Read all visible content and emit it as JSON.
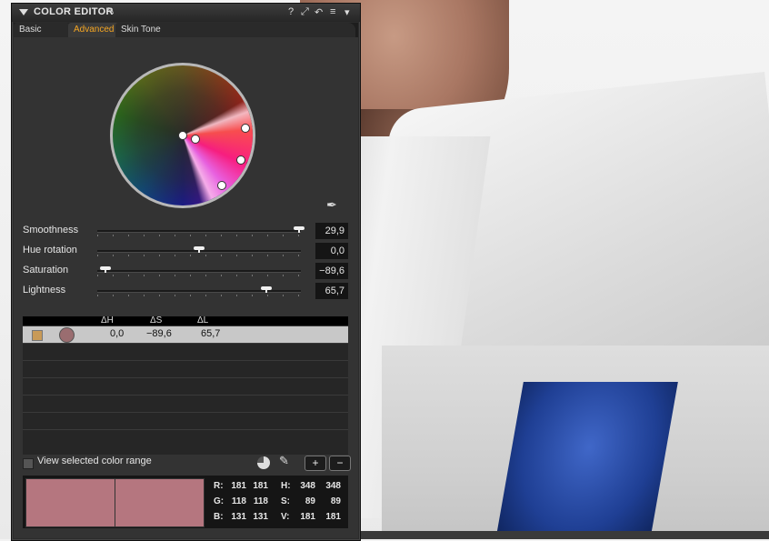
{
  "panel": {
    "title": "COLOR EDITOR",
    "title_icons": [
      "?",
      "⤢",
      "↶",
      "≡",
      "▾"
    ]
  },
  "tabs": [
    {
      "label": "Basic",
      "active": false
    },
    {
      "label": "Advanced",
      "active": true
    },
    {
      "label": "Skin Tone",
      "active": false
    }
  ],
  "sliders": [
    {
      "label": "Smoothness",
      "value": "29,9",
      "level": 0.99
    },
    {
      "label": "Hue rotation",
      "value": "0,0",
      "level": 0.5
    },
    {
      "label": "Saturation",
      "value": "−89,6",
      "level": 0.04
    },
    {
      "label": "Lightness",
      "value": "65,7",
      "level": 0.83
    }
  ],
  "table": {
    "headers": [
      "ΔH",
      "ΔS",
      "ΔL"
    ],
    "rows": [
      {
        "dh": "0,0",
        "ds": "−89,6",
        "dl": "65,7",
        "swatch_color": "#9a6d70"
      }
    ]
  },
  "view_range": {
    "label": "View selected color range",
    "checked": false
  },
  "buttons": {
    "plus": "+",
    "minus": "−"
  },
  "preview": {
    "color_left": "#b5767f",
    "color_right": "#b5767f",
    "R": {
      "label": "R:",
      "a": "181",
      "b": "181"
    },
    "G": {
      "label": "G:",
      "a": "118",
      "b": "118"
    },
    "B": {
      "label": "B:",
      "a": "131",
      "b": "131"
    },
    "H": {
      "label": "H:",
      "a": "348",
      "b": "348"
    },
    "S": {
      "label": "S:",
      "a": "89",
      "b": "89"
    },
    "V": {
      "label": "V:",
      "a": "181",
      "b": "181"
    }
  }
}
